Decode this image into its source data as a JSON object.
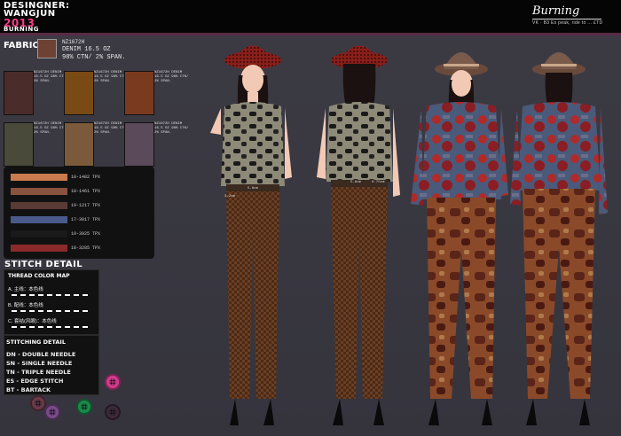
{
  "brand": {
    "line1": "DESINGNER:",
    "line2": "WANGJUN",
    "line3": "2013",
    "line4": "BURNING"
  },
  "logo": {
    "script": "Burning",
    "tagline": "VK · B3 Es peak, ride to ...  £TD"
  },
  "fabric": {
    "title": "FABRIC",
    "code": "NZ1672H",
    "line1": "DENIM 16.5 OZ",
    "line2": "98% CTN/ 2% SPAN."
  },
  "swatches": [
    {
      "color": "#4a2c2a",
      "label": "NZ1672H DENIM 16.5 OZ 98% CTN/ 2% SPAN."
    },
    {
      "color": "#7a4a14",
      "label": "NZ1672H DENIM 16.5 OZ 98% CTN/ 2% SPAN."
    },
    {
      "color": "#7a3a20",
      "label": "NZ1672H DENIM 16.5 OZ 98% CTN/ 2% SPAN."
    },
    {
      "color": "#4a4a3a",
      "label": "NZ1672H DENIM 16.5 OZ 98% CTN/ 2% SPAN."
    },
    {
      "color": "#7a5a3a",
      "label": "NZ1672H DENIM 16.5 OZ 98% CTN/ 2% SPAN."
    },
    {
      "color": "#5a4a5a",
      "label": "NZ1672H DENIM 16.5 OZ 98% CTN/ 2% SPAN."
    }
  ],
  "palette": [
    {
      "color": "#c97b4e",
      "label": "18-1482 TPX"
    },
    {
      "color": "#8a5340",
      "label": "18-1461 TPX"
    },
    {
      "color": "#5a3a35",
      "label": "19-1217 TPX"
    },
    {
      "color": "#4a5a8a",
      "label": "17-3017 TPX"
    },
    {
      "color": "#1a1a1a",
      "label": "19-3925 TPX"
    },
    {
      "color": "#8a2a2a",
      "label": "18-3285 TPX"
    }
  ],
  "stitch": {
    "title": "STITCH DETAIL",
    "thread_head": "THREAD COLOR  MAP",
    "thread_a": "A. 主线：本色线",
    "thread_b": "B. 配线：本色线",
    "thread_c": "C. 套结(风眼)：本色线",
    "detail_head": "STITCHING DETAIL",
    "dn": "DN - DOUBLE NEEDLE",
    "sn": "SN - SINGLE NEEDLE",
    "tn": "TN - TRIPLE NEEDLE",
    "es": "ES - EDGE STITCH",
    "bt": "BT - BARTACK"
  },
  "buttons": [
    {
      "color": "#d23b8c"
    },
    {
      "color": "#6a3a4a"
    },
    {
      "color": "#7a4a8a"
    },
    {
      "color": "#1a8a4a"
    },
    {
      "color": "#3a2a3a"
    }
  ],
  "measures": [
    "5.8cm",
    "3.2cm",
    "5.8cm",
    "0.75cm"
  ]
}
